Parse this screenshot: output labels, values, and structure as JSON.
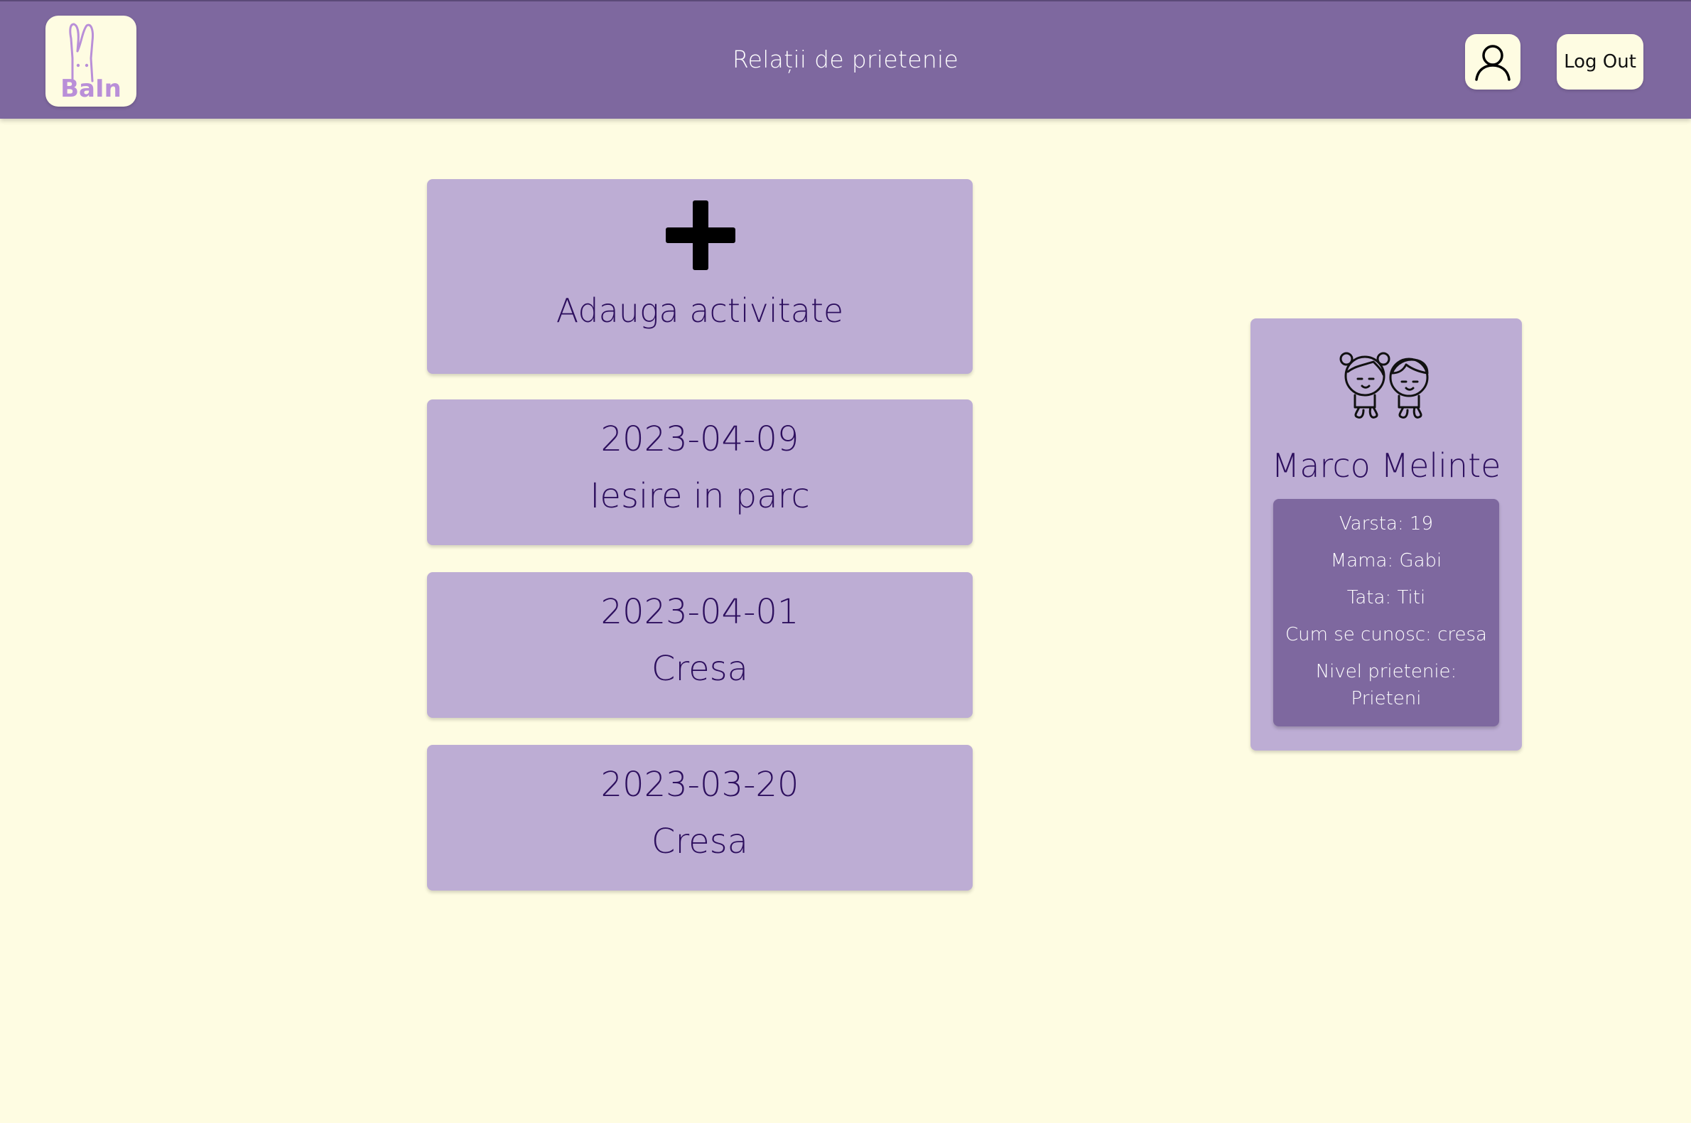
{
  "header": {
    "logo_text": "BaIn",
    "title": "Relații de prietenie",
    "profile_icon": "user-icon",
    "logout_label": "Log Out"
  },
  "colors": {
    "header_bg": "#7e689f",
    "page_bg": "#fefce2",
    "card_bg": "#bdadd4",
    "text_dark": "#2d0f5e",
    "logo_purple": "#b98fd8"
  },
  "add_activity": {
    "icon": "plus-icon",
    "label": "Adauga activitate"
  },
  "activities": [
    {
      "date": "2023-04-09",
      "name": "Iesire in parc"
    },
    {
      "date": "2023-04-01",
      "name": "Cresa"
    },
    {
      "date": "2023-03-20",
      "name": "Cresa"
    }
  ],
  "friend": {
    "icon": "children-icon",
    "name": "Marco Melinte",
    "details": {
      "age": "Varsta: 19",
      "mother": "Mama: Gabi",
      "father": "Tata: Titi",
      "how_met": "Cum se cunosc: cresa",
      "level_label": "Nivel prietenie:",
      "level_value": "Prieteni"
    }
  }
}
